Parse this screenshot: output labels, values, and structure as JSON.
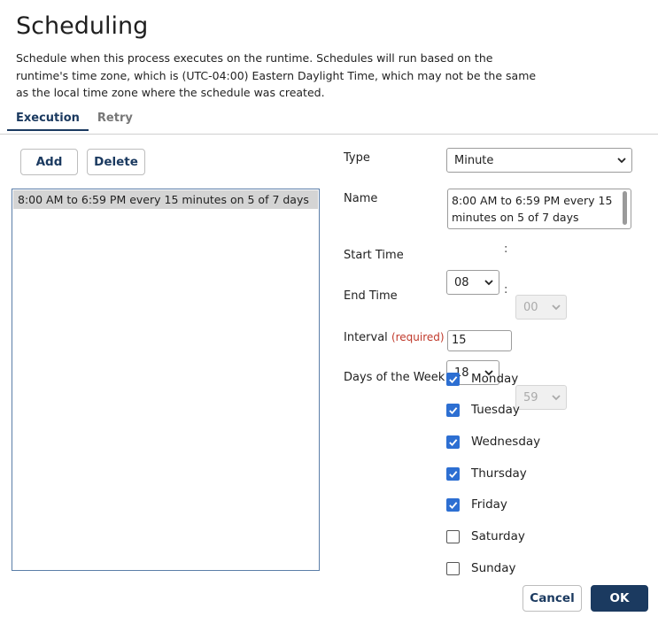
{
  "header": {
    "title": "Scheduling",
    "description": "Schedule when this process executes on the runtime. Schedules will run based on the runtime's time zone, which is (UTC-04:00) Eastern Daylight Time, which may not be the same as the local time zone where the schedule was created."
  },
  "tabs": [
    {
      "label": "Execution",
      "active": true
    },
    {
      "label": "Retry",
      "active": false
    }
  ],
  "toolbar": {
    "add_label": "Add",
    "delete_label": "Delete"
  },
  "schedule_list": {
    "items": [
      "8:00 AM to 6:59 PM every 15 minutes on 5 of 7 days"
    ]
  },
  "form": {
    "type_label": "Type",
    "type_value": "Minute",
    "name_label": "Name",
    "name_value": "8:00 AM to 6:59 PM every 15 minutes on 5 of 7 days",
    "start_time_label": "Start Time",
    "start_hour": "08",
    "start_minute": "00",
    "end_time_label": "End Time",
    "end_hour": "18",
    "end_minute": "59",
    "time_separator": ":",
    "interval_label": "Interval",
    "interval_required": "(required)",
    "interval_value": "15",
    "days_label": "Days of the Week",
    "days": [
      {
        "label": "Monday",
        "checked": true
      },
      {
        "label": "Tuesday",
        "checked": true
      },
      {
        "label": "Wednesday",
        "checked": true
      },
      {
        "label": "Thursday",
        "checked": true
      },
      {
        "label": "Friday",
        "checked": true
      },
      {
        "label": "Saturday",
        "checked": false
      },
      {
        "label": "Sunday",
        "checked": false
      }
    ]
  },
  "footer": {
    "cancel_label": "Cancel",
    "ok_label": "OK"
  },
  "colors": {
    "accent": "#1b3a60",
    "checkbox": "#2d6fd2",
    "required": "#c0392b"
  }
}
